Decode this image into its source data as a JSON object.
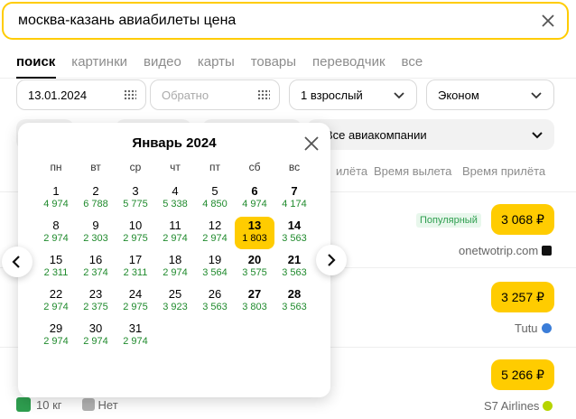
{
  "search": {
    "query": "москва-казань авиабилеты цена"
  },
  "tabs": [
    "поиск",
    "картинки",
    "видео",
    "карты",
    "товары",
    "переводчик",
    "все"
  ],
  "form": {
    "date_from": "13.01.2024",
    "date_back_placeholder": "Обратно",
    "passengers": "1 взрослый",
    "class": "Эконом",
    "airlines": "Все авиакомпании"
  },
  "sort": [
    "Время вылета",
    "Время прилёта"
  ],
  "sort_partial": "илёта",
  "results": [
    {
      "badge": "Популярный",
      "price": "3 068 ₽",
      "provider": "onetwotrip.com"
    },
    {
      "price": "3 257 ₽",
      "provider": "Tutu"
    },
    {
      "price": "5 266 ₽",
      "provider": "S7 Airlines"
    }
  ],
  "footer": {
    "baggage": "10 кг",
    "nobag": "Нет"
  },
  "calendar": {
    "title": "Январь 2024",
    "weekdays": [
      "пн",
      "вт",
      "ср",
      "чт",
      "пт",
      "сб",
      "вс"
    ],
    "days": [
      {
        "d": "1",
        "p": "4 974"
      },
      {
        "d": "2",
        "p": "6 788"
      },
      {
        "d": "3",
        "p": "5 775"
      },
      {
        "d": "4",
        "p": "5 338"
      },
      {
        "d": "5",
        "p": "4 850"
      },
      {
        "d": "6",
        "p": "4 974"
      },
      {
        "d": "7",
        "p": "4 174"
      },
      {
        "d": "8",
        "p": "2 974"
      },
      {
        "d": "9",
        "p": "2 303"
      },
      {
        "d": "10",
        "p": "2 975"
      },
      {
        "d": "11",
        "p": "2 974"
      },
      {
        "d": "12",
        "p": "2 974"
      },
      {
        "d": "13",
        "p": "1 803",
        "selected": true
      },
      {
        "d": "14",
        "p": "3 563"
      },
      {
        "d": "15",
        "p": "2 311"
      },
      {
        "d": "16",
        "p": "2 374"
      },
      {
        "d": "17",
        "p": "2 311"
      },
      {
        "d": "18",
        "p": "2 974"
      },
      {
        "d": "19",
        "p": "3 564"
      },
      {
        "d": "20",
        "p": "3 575"
      },
      {
        "d": "21",
        "p": "3 563"
      },
      {
        "d": "22",
        "p": "2 974"
      },
      {
        "d": "23",
        "p": "2 375"
      },
      {
        "d": "24",
        "p": "2 975"
      },
      {
        "d": "25",
        "p": "3 923"
      },
      {
        "d": "26",
        "p": "3 563"
      },
      {
        "d": "27",
        "p": "3 803"
      },
      {
        "d": "28",
        "p": "3 563"
      },
      {
        "d": "29",
        "p": "2 974"
      },
      {
        "d": "30",
        "p": "2 974"
      },
      {
        "d": "31",
        "p": "2 974"
      }
    ]
  },
  "colors": {
    "accent": "#ffcc00",
    "price_green": "#1f8a2c"
  }
}
